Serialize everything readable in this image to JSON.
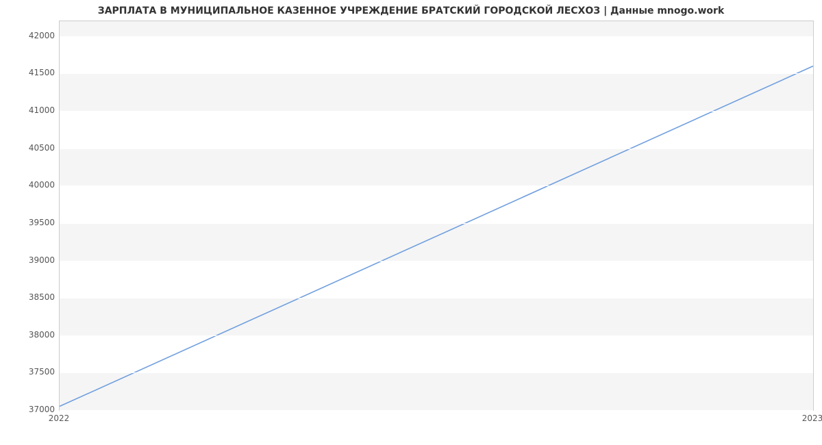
{
  "chart_data": {
    "type": "line",
    "title": "ЗАРПЛАТА В МУНИЦИПАЛЬНОЕ КАЗЕННОЕ УЧРЕЖДЕНИЕ БРАТСКИЙ ГОРОДСКОЙ ЛЕСХОЗ | Данные mnogo.work",
    "x": [
      2022,
      2023
    ],
    "values": [
      37050,
      41600
    ],
    "xticks": [
      2022,
      2023
    ],
    "yticks": [
      37000,
      37500,
      38000,
      38500,
      39000,
      39500,
      40000,
      40500,
      41000,
      41500,
      42000
    ],
    "xlabel": "",
    "ylabel": "",
    "xlim": [
      2022,
      2023
    ],
    "ylim": [
      37000,
      42200
    ],
    "line_color": "#6f9fde"
  }
}
